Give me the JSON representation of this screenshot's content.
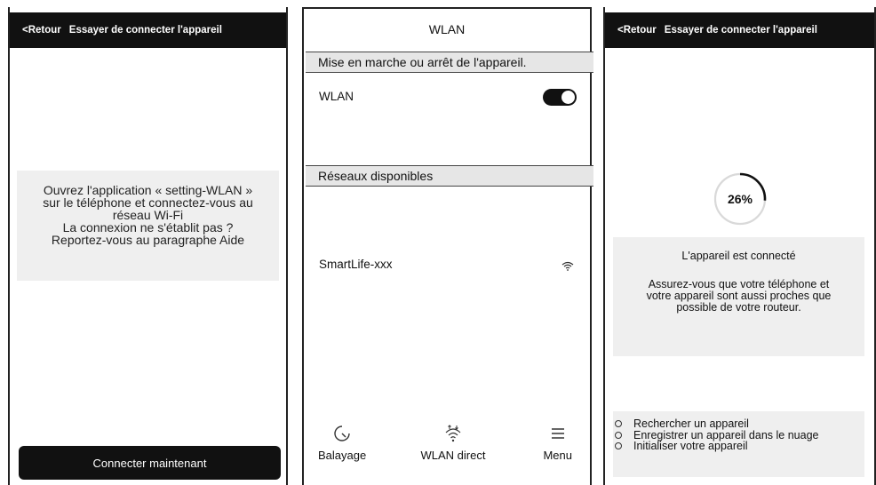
{
  "screen1": {
    "back_label": "<Retour",
    "title": "Essayer de connecter l'appareil",
    "message_lines": [
      "Ouvrez l'application « setting-WLAN »",
      "sur le téléphone et connectez-vous au",
      "réseau Wi-Fi",
      "La connexion ne s'établit pas ?",
      "Reportez-vous au paragraphe Aide"
    ],
    "connect_button": "Connecter maintenant"
  },
  "screen2": {
    "title": "WLAN",
    "power_section": "Mise en marche ou arrêt de l'appareil.",
    "wlan_label": "WLAN",
    "wlan_toggle_on": true,
    "networks_section": "Réseaux disponibles",
    "network_ssid": "SmartLife-xxx",
    "nav": [
      {
        "label": "Balayage",
        "icon": "scan-icon"
      },
      {
        "label": "WLAN direct",
        "icon": "wifi-direct-icon"
      },
      {
        "label": "Menu",
        "icon": "hamburger-menu-icon"
      }
    ]
  },
  "screen3": {
    "back_label": "<Retour",
    "title": "Essayer de connecter l'appareil",
    "progress_text": "26%",
    "progress_value": 0.26,
    "status": "L'appareil est connecté",
    "advice_lines": [
      "Assurez-vous que votre téléphone et",
      "votre appareil sont aussi proches que",
      "possible de votre routeur."
    ],
    "options": [
      "Rechercher un appareil",
      "Enregistrer un appareil dans le nuage",
      "Initialiser votre appareil"
    ]
  }
}
